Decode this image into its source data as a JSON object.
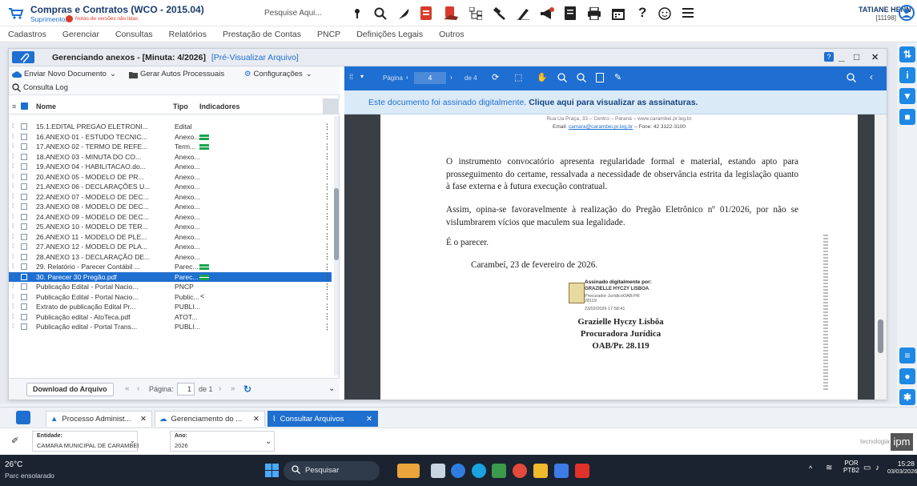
{
  "app": {
    "title": "Compras e Contratos (WCO - 2015.04)",
    "subtitle": "Suprimentos",
    "notes_badge": "Notas de versões não lidas",
    "search_placeholder": "Pesquise Aqui...",
    "user_name": "TATIANE HENN",
    "user_id": "[11198]"
  },
  "menu": [
    "Cadastros",
    "Gerenciar",
    "Consultas",
    "Relatórios",
    "Prestação de Contas",
    "PNCP",
    "Definições Legais",
    "Outros"
  ],
  "modal": {
    "title": "Gerenciando anexos - [Minuta: 4/2026]",
    "title_suffix": "[Pré-Visualizar Arquivo]",
    "controls": {
      "min": "_",
      "max": "□",
      "close": "✕"
    }
  },
  "left_toolbar": {
    "send_new": "Enviar Novo Documento",
    "gen_autos": "Gerar Autos Processuais",
    "config": "Configurações",
    "consult_log": "Consulta Log"
  },
  "table": {
    "col_name": "Nome",
    "col_type": "Tipo",
    "col_ind": "Indicadores",
    "rows": [
      {
        "name": "15.1.EDITAL PREGAO ELETRONI...",
        "type": "Edital",
        "ind": "",
        "selected": false
      },
      {
        "name": "16.ANEXO 01 - ESTUDO TECNIC...",
        "type": "Anexo...",
        "ind": "green",
        "selected": false
      },
      {
        "name": "17.ANEXO 02 - TERMO DE REFE...",
        "type": "Term...",
        "ind": "green",
        "selected": false
      },
      {
        "name": "18.ANEXO 03 - MINUTA DO CO...",
        "type": "Anexo...",
        "ind": "",
        "selected": false
      },
      {
        "name": "19.ANEXO 04 - HABILITACAO.do...",
        "type": "Anexo...",
        "ind": "",
        "selected": false
      },
      {
        "name": "20.ANEXO 05 - MODELO DE PR...",
        "type": "Anexo...",
        "ind": "",
        "selected": false
      },
      {
        "name": "21.ANEXO 06 - DECLARAÇÕES U...",
        "type": "Anexo...",
        "ind": "",
        "selected": false
      },
      {
        "name": "22.ANEXO 07 - MODELO DE DEC...",
        "type": "Anexo...",
        "ind": "",
        "selected": false
      },
      {
        "name": "23.ANEXO 08 - MODELO DE DEC...",
        "type": "Anexo...",
        "ind": "",
        "selected": false
      },
      {
        "name": "24.ANEXO 09 - MODELO DE DEC...",
        "type": "Anexo...",
        "ind": "",
        "selected": false
      },
      {
        "name": "25.ANEXO 10 - MODELO DE TER...",
        "type": "Anexo...",
        "ind": "",
        "selected": false
      },
      {
        "name": "26.ANEXO 11 - MODELO DE PLE...",
        "type": "Anexo...",
        "ind": "",
        "selected": false
      },
      {
        "name": "27.ANEXO 12 - MODELO DE PLA...",
        "type": "Anexo...",
        "ind": "",
        "selected": false
      },
      {
        "name": "28.ANEXO 13 - DECLARAÇÃO DE...",
        "type": "Anexo...",
        "ind": "",
        "selected": false
      },
      {
        "name": "29. Relatório - Parecer Contábil ...",
        "type": "Parec...",
        "ind": "green",
        "selected": false
      },
      {
        "name": "30. Parecer 30 Pregão.pdf",
        "type": "Parec...",
        "ind": "green",
        "selected": true
      },
      {
        "name": "Publicação Edital - Portal Nacio...",
        "type": "PNCP",
        "ind": "",
        "selected": false
      },
      {
        "name": "Publicação Edital - Portal Nacio...",
        "type": "Public...",
        "ind": "share",
        "selected": false
      },
      {
        "name": "Extrato de publicação Edital Pr...",
        "type": "PUBLI...",
        "ind": "",
        "selected": false
      },
      {
        "name": "Publicação edital - AtoTeca.pdf",
        "type": "ATOT...",
        "ind": "",
        "selected": false
      },
      {
        "name": "Publicação edital - Portal Trans...",
        "type": "PUBLI...",
        "ind": "",
        "selected": false
      }
    ]
  },
  "left_footer": {
    "download": "Download do Arquivo",
    "page_label": "Página:",
    "page": "1",
    "of": "de 1"
  },
  "viewer": {
    "page_label": "Página",
    "page": "4",
    "of": "de 4",
    "banner_text": "Este documento foi assinado digitalmente.",
    "banner_link": "Clique aqui para visualizar as assinaturas."
  },
  "document": {
    "header_line1": "Rua Ua Praça, 33 – Centro – Paraná – www.carambei.pr.leg.br",
    "header_line2_prefix": "Email:",
    "header_email": "camara@carambei.pr.leg.br",
    "header_line2_suffix": "– Fone: 42 3122-3100",
    "para1": "O instrumento convocatório apresenta regularidade formal e material, estando apto para prosseguimento do certame, ressalvada a necessidade de observância estrita da legislação quanto à fase externa e à futura execução contratual.",
    "para2": "Assim, opina-se favoravelmente à realização do Pregão Eletrônico nº 01/2026, por não se vislumbrarem vícios que maculem sua legalidade.",
    "para3": "É o parecer.",
    "place_date": "Carambeí, 23 de fevereiro de 2026.",
    "sig_label": "Assinado digitalmente por:",
    "sig_name": "GRAZIELLE HYCZY LISBOA",
    "sig_role": "Procurador JurídicoOAB:PR 28119",
    "sig_time": "23/02/2026 17:58:41",
    "signer_name": "Grazielle Hyczy Lisbôa",
    "signer_role": "Procuradora Jurídica",
    "signer_oab": "OAB/Pr. 28.119"
  },
  "tabs": [
    {
      "label": "Processo Administ...",
      "active": false
    },
    {
      "label": "Gerenciamento do ...",
      "active": false
    },
    {
      "label": "Consultar Arquivos",
      "active": true
    }
  ],
  "entity": {
    "entity_label": "Entidade:",
    "entity_value": "CAMARA MUNICIPAL DE CARAMBEI",
    "year_label": "Ano:",
    "year_value": "2026",
    "brand": "tecnologia",
    "brand_mark": "ipm"
  },
  "taskbar": {
    "weather_temp": "26°C",
    "weather_desc": "Parc ensolarado",
    "search_placeholder": "Pesquisar",
    "lang1": "POR",
    "lang2": "PTB2",
    "time": "15:28",
    "date": "03/03/2026"
  },
  "colors": {
    "accent": "#1e6fd0",
    "green": "#1aa34a",
    "red": "#d83b2b"
  }
}
